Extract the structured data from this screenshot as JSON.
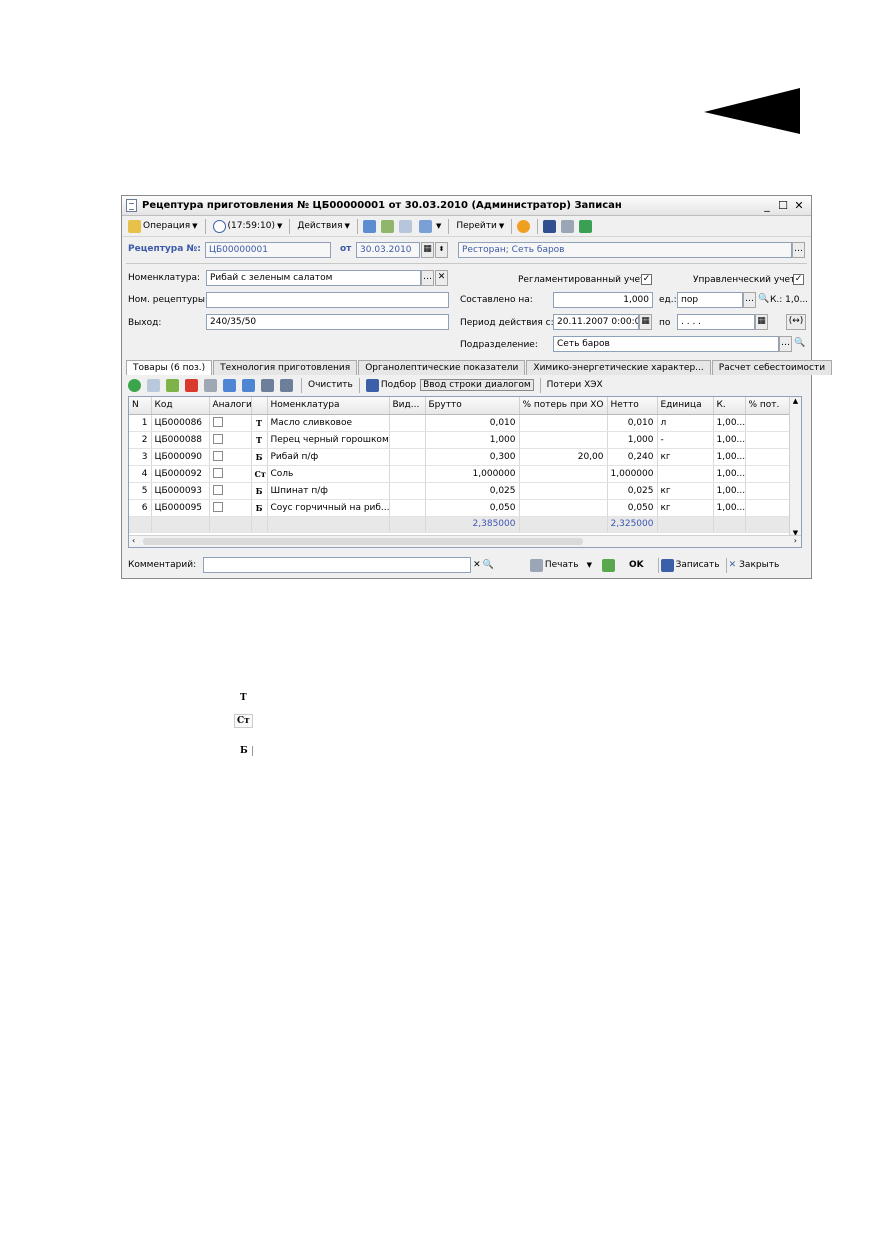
{
  "window": {
    "title": "Рецептура приготовления № ЦБ00000001 от 30.03.2010 (Администратор) Записан",
    "min": "_",
    "max": "☐",
    "close": "✕"
  },
  "toolbar": {
    "operation": "Операция",
    "time": "(17:59:10)",
    "actions": "Действия",
    "goto": "Перейти"
  },
  "header": {
    "recipe_label": "Рецептура №:",
    "recipe_number": "ЦБ00000001",
    "date_label": "от",
    "date": "30.03.2010",
    "restaurant": "Ресторан; Сеть баров"
  },
  "form": {
    "nomenclature_label": "Номенклатура:",
    "nomenclature_value": "Рибай с зеленым салатом",
    "recipe_nom_label": "Ном. рецептуры:",
    "recipe_nom_value": "",
    "output_label": "Выход:",
    "output_value": "240/35/50",
    "regl_label": "Регламентированный учет",
    "mgmt_label": "Управленческий учет",
    "composed_label": "Составлено на:",
    "composed_value": "1,000",
    "unit_label": "ед.:",
    "unit_value": "пор",
    "k_label": "К.: 1,0...",
    "period_label": "Период действия с:",
    "period_from": "20.11.2007 0:00:0",
    "period_to_label": "по",
    "period_to": " .  .   .  .",
    "dept_label": "Подразделение:",
    "dept_value": "Сеть баров"
  },
  "tabs": [
    "Товары (6 поз.)",
    "Технология приготовления",
    "Органолептические показатели",
    "Химико-энергетические характер...",
    "Расчет себестоимости"
  ],
  "table_toolbar": {
    "clear": "Очистить",
    "pick": "Подбор",
    "dialog": "Ввод строки диалогом",
    "losses": "Потери ХЭХ"
  },
  "table": {
    "columns": [
      "N",
      "Код",
      "Аналоги",
      "",
      "Номенклатура",
      "Вид...",
      "Брутто",
      "% потерь при ХО",
      "Нетто",
      "Единица",
      "К.",
      "% пот."
    ],
    "rows": [
      {
        "n": "1",
        "code": "ЦБ000086",
        "mark": "Т",
        "name": "Масло сливковое",
        "brutto": "0,010",
        "loss": "",
        "netto": "0,010",
        "unit": "л",
        "k": "1,00..."
      },
      {
        "n": "2",
        "code": "ЦБ000088",
        "mark": "Т",
        "name": "Перец черный горошком",
        "brutto": "1,000",
        "loss": "",
        "netto": "1,000",
        "unit": "-",
        "k": "1,00..."
      },
      {
        "n": "3",
        "code": "ЦБ000090",
        "mark": "Б",
        "name": "Рибай п/ф",
        "brutto": "0,300",
        "loss": "20,00",
        "netto": "0,240",
        "unit": "кг",
        "k": "1,00..."
      },
      {
        "n": "4",
        "code": "ЦБ000092",
        "mark": "Ст",
        "name": "Соль",
        "brutto": "1,000000",
        "loss": "",
        "netto": "1,000000",
        "unit": "",
        "k": "1,00..."
      },
      {
        "n": "5",
        "code": "ЦБ000093",
        "mark": "Б",
        "name": "Шпинат п/ф",
        "brutto": "0,025",
        "loss": "",
        "netto": "0,025",
        "unit": "кг",
        "k": "1,00..."
      },
      {
        "n": "6",
        "code": "ЦБ000095",
        "mark": "Б",
        "name": "Соус горчичный на риб...",
        "brutto": "0,050",
        "loss": "",
        "netto": "0,050",
        "unit": "кг",
        "k": "1,00..."
      }
    ],
    "total_brutto": "2,385000",
    "total_netto": "2,325000"
  },
  "bottom": {
    "comment_label": "Комментарий:",
    "print": "Печать",
    "ok": "OK",
    "save": "Записать",
    "close": "Закрыть"
  },
  "legend": [
    "Т",
    "Ст",
    "Б"
  ]
}
